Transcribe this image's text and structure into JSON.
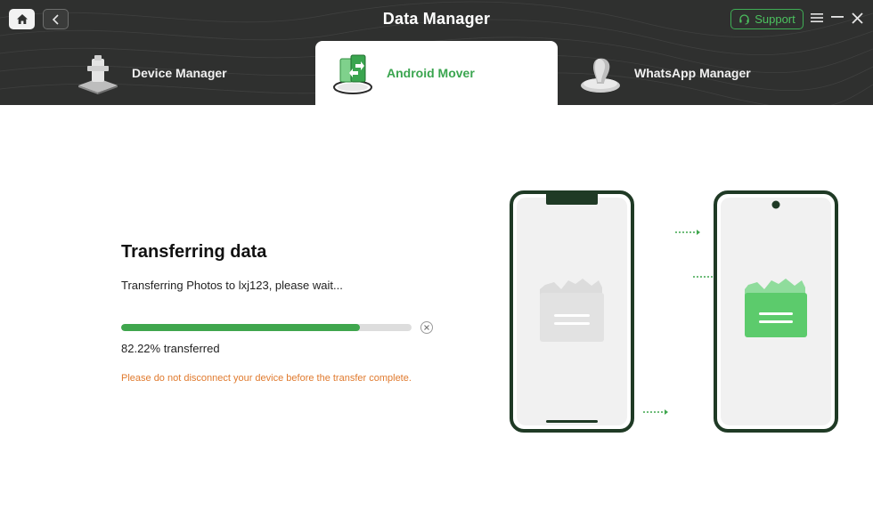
{
  "header": {
    "title": "Data Manager",
    "support_label": "Support",
    "home_icon": "home-icon",
    "back_icon": "chevron-left-icon",
    "menu_icon": "hamburger-menu-icon",
    "minimize_icon": "minimize-icon",
    "close_icon": "close-icon"
  },
  "tabs": [
    {
      "label": "Device Manager",
      "icon": "device-manager-icon",
      "active": false
    },
    {
      "label": "Android Mover",
      "icon": "android-mover-icon",
      "active": true
    },
    {
      "label": "WhatsApp Manager",
      "icon": "whatsapp-manager-icon",
      "active": false
    }
  ],
  "transfer": {
    "title": "Transferring data",
    "status": "Transferring Photos to lxj123, please wait...",
    "progress": 0.8222,
    "percent_label": "82.22% transferred",
    "warning": "Please do not disconnect your device before the transfer complete."
  },
  "colors": {
    "header_bg": "#2f302f",
    "accent_green": "#3fa64d",
    "warning_orange": "#e07a2e",
    "phone_frame": "#1f3a25"
  }
}
